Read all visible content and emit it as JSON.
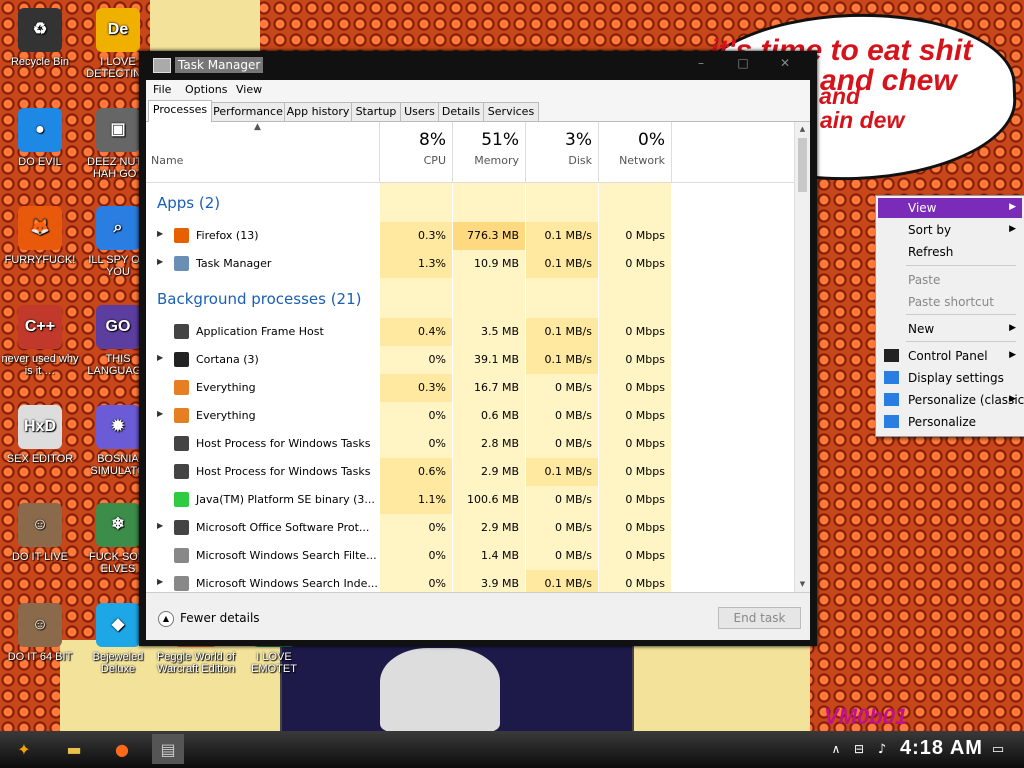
{
  "desktop": {
    "bubble_line1": "it's time to eat shit",
    "bubble_line2": "and chew",
    "bubble_line3": "s and",
    "bubble_line4": "ain dew",
    "watermark": "VM0b01",
    "icons": [
      {
        "label": "Recycle Bin",
        "glyph": "♻",
        "color": "#333"
      },
      {
        "label": "I LOVE DETECTING",
        "glyph": "De",
        "color": "#f0b000"
      },
      {
        "label": "DO EVIL",
        "glyph": "●",
        "color": "#1e88e5"
      },
      {
        "label": "DEEZ NUTZ HAH GOT",
        "glyph": "▣",
        "color": "#666"
      },
      {
        "label": "FURRYFUCK!",
        "glyph": "🦊",
        "color": "#e8590c"
      },
      {
        "label": "ILL SPY ON YOU",
        "glyph": "⌕",
        "color": "#2a7de1"
      },
      {
        "label": "never used why is it …",
        "glyph": "C++",
        "color": "#c0392b"
      },
      {
        "label": "THIS LANGUAGE",
        "glyph": "GO",
        "color": "#5b3ea0"
      },
      {
        "label": "SEX EDITOR",
        "glyph": "HxD",
        "color": "#ddd"
      },
      {
        "label": "BOSNIA SIMULATO",
        "glyph": "✹",
        "color": "#6b5bd6"
      },
      {
        "label": "DO IT LIVE",
        "glyph": "☺",
        "color": "#8a6a4a"
      },
      {
        "label": "FUCK SOM ELVES",
        "glyph": "❄",
        "color": "#3c8c4a"
      },
      {
        "label": "DO IT 64 BIT",
        "glyph": "☺",
        "color": "#8a6a4a"
      },
      {
        "label": "Bejeweled Deluxe",
        "glyph": "◆",
        "color": "#1ea7e6"
      },
      {
        "label": "Peggle World of Warcraft Edition",
        "glyph": "P",
        "color": "#f36c21"
      },
      {
        "label": "I LOVE EMOTET",
        "glyph": "P",
        "color": "#1a8f4a"
      }
    ]
  },
  "taskbar": {
    "clock": "4:18 AM"
  },
  "taskmanager": {
    "title": "Task Manager",
    "menu": [
      "File",
      "Options",
      "View"
    ],
    "tabs": [
      "Processes",
      "Performance",
      "App history",
      "Startup",
      "Users",
      "Details",
      "Services"
    ],
    "columns": {
      "name": "Name",
      "cpu": {
        "pct": "8%",
        "label": "CPU"
      },
      "memory": {
        "pct": "51%",
        "label": "Memory"
      },
      "disk": {
        "pct": "3%",
        "label": "Disk"
      },
      "network": {
        "pct": "0%",
        "label": "Network"
      }
    },
    "groups": [
      {
        "title": "Apps (2)"
      },
      {
        "title": "Background processes (21)"
      }
    ],
    "apps": [
      {
        "name": "Firefox (13)",
        "cpu": "0.3%",
        "mem": "776.3 MB",
        "disk": "0.1 MB/s",
        "net": "0 Mbps",
        "expand": "▶",
        "icon": "#e66000"
      },
      {
        "name": "Task Manager",
        "cpu": "1.3%",
        "mem": "10.9 MB",
        "disk": "0.1 MB/s",
        "net": "0 Mbps",
        "expand": "▶",
        "icon": "#6a8fb5"
      }
    ],
    "background": [
      {
        "name": "Application Frame Host",
        "cpu": "0.4%",
        "mem": "3.5 MB",
        "disk": "0.1 MB/s",
        "net": "0 Mbps",
        "expand": "",
        "icon": "#444"
      },
      {
        "name": "Cortana (3)",
        "cpu": "0%",
        "mem": "39.1 MB",
        "disk": "0.1 MB/s",
        "net": "0 Mbps",
        "expand": "▶",
        "icon": "#222"
      },
      {
        "name": "Everything",
        "cpu": "0.3%",
        "mem": "16.7 MB",
        "disk": "0 MB/s",
        "net": "0 Mbps",
        "expand": "",
        "icon": "#e67e22"
      },
      {
        "name": "Everything",
        "cpu": "0%",
        "mem": "0.6 MB",
        "disk": "0 MB/s",
        "net": "0 Mbps",
        "expand": "▶",
        "icon": "#e67e22"
      },
      {
        "name": "Host Process for Windows Tasks",
        "cpu": "0%",
        "mem": "2.8 MB",
        "disk": "0 MB/s",
        "net": "0 Mbps",
        "expand": "",
        "icon": "#444"
      },
      {
        "name": "Host Process for Windows Tasks",
        "cpu": "0.6%",
        "mem": "2.9 MB",
        "disk": "0.1 MB/s",
        "net": "0 Mbps",
        "expand": "",
        "icon": "#444"
      },
      {
        "name": "Java(TM) Platform SE binary (3...",
        "cpu": "1.1%",
        "mem": "100.6 MB",
        "disk": "0 MB/s",
        "net": "0 Mbps",
        "expand": "",
        "icon": "#2ecc40"
      },
      {
        "name": "Microsoft Office Software Prot...",
        "cpu": "0%",
        "mem": "2.9 MB",
        "disk": "0 MB/s",
        "net": "0 Mbps",
        "expand": "▶",
        "icon": "#444"
      },
      {
        "name": "Microsoft Windows Search Filte...",
        "cpu": "0%",
        "mem": "1.4 MB",
        "disk": "0 MB/s",
        "net": "0 Mbps",
        "expand": "",
        "icon": "#888"
      },
      {
        "name": "Microsoft Windows Search Inde...",
        "cpu": "0%",
        "mem": "3.9 MB",
        "disk": "0.1 MB/s",
        "net": "0 Mbps",
        "expand": "▶",
        "icon": "#888"
      }
    ],
    "fewer_details": "Fewer details",
    "end_task": "End task"
  },
  "context_menu": {
    "items": [
      {
        "label": "View",
        "arrow": "▶",
        "state": "highlight"
      },
      {
        "label": "Sort by",
        "arrow": "▶",
        "state": "normal"
      },
      {
        "label": "Refresh",
        "arrow": "",
        "state": "normal"
      },
      {
        "label": "Paste",
        "arrow": "",
        "state": "disabled"
      },
      {
        "label": "Paste shortcut",
        "arrow": "",
        "state": "disabled"
      },
      {
        "label": "New",
        "arrow": "▶",
        "state": "normal"
      },
      {
        "label": "Control Panel",
        "arrow": "▶",
        "state": "normal"
      },
      {
        "label": "Display settings",
        "arrow": "",
        "state": "normal"
      },
      {
        "label": "Personalize (classic)",
        "arrow": "▶",
        "state": "normal"
      },
      {
        "label": "Personalize",
        "arrow": "",
        "state": "normal"
      }
    ]
  },
  "colors": {
    "highlight": "#7a2bb8",
    "group_blue": "#1a5fb4",
    "heat_light": "#fff4c4",
    "heat_mid": "#ffe9a0"
  }
}
